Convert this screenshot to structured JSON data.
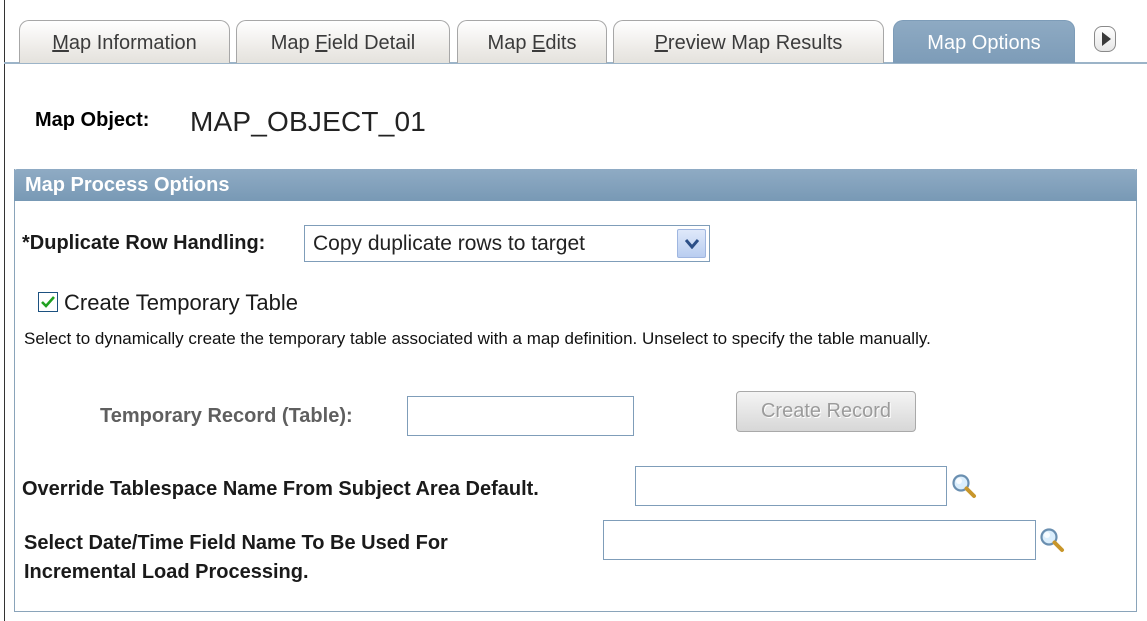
{
  "tabs": [
    {
      "label": "Map Information",
      "accesskey": "M"
    },
    {
      "label": "Map Field Detail",
      "accesskey": "F"
    },
    {
      "label": "Map Edits",
      "accesskey": "E"
    },
    {
      "label": "Preview Map Results",
      "accesskey": "P"
    },
    {
      "label": "Map Options",
      "accesskey": ""
    }
  ],
  "active_tab": "Map Options",
  "map_object": {
    "label": "Map Object:",
    "value": "MAP_OBJECT_01"
  },
  "group": {
    "title": "Map Process Options"
  },
  "duplicate_row": {
    "label": "*Duplicate Row Handling:",
    "selected": "Copy duplicate rows to target"
  },
  "temp_table": {
    "label": "Create Temporary Table",
    "checked": true,
    "help": "Select to dynamically create the temporary table associated with a map definition. Unselect to specify the table manually."
  },
  "temp_record": {
    "label": "Temporary Record (Table):",
    "value": ""
  },
  "create_record_button": "Create Record",
  "override_tablespace": {
    "label": "Override Tablespace Name From Subject Area Default.",
    "value": ""
  },
  "datetime_field": {
    "label_line1": "Select Date/Time Field Name To Be Used For",
    "label_line2": "Incremental Load Processing.",
    "value": ""
  },
  "colors": {
    "accent": "#7d9cb8",
    "header": "#8fabc4"
  },
  "icons": {
    "lookup": "magnifier-icon",
    "next_tab": "next-tab-icon",
    "dropdown": "chevron-down-icon"
  }
}
